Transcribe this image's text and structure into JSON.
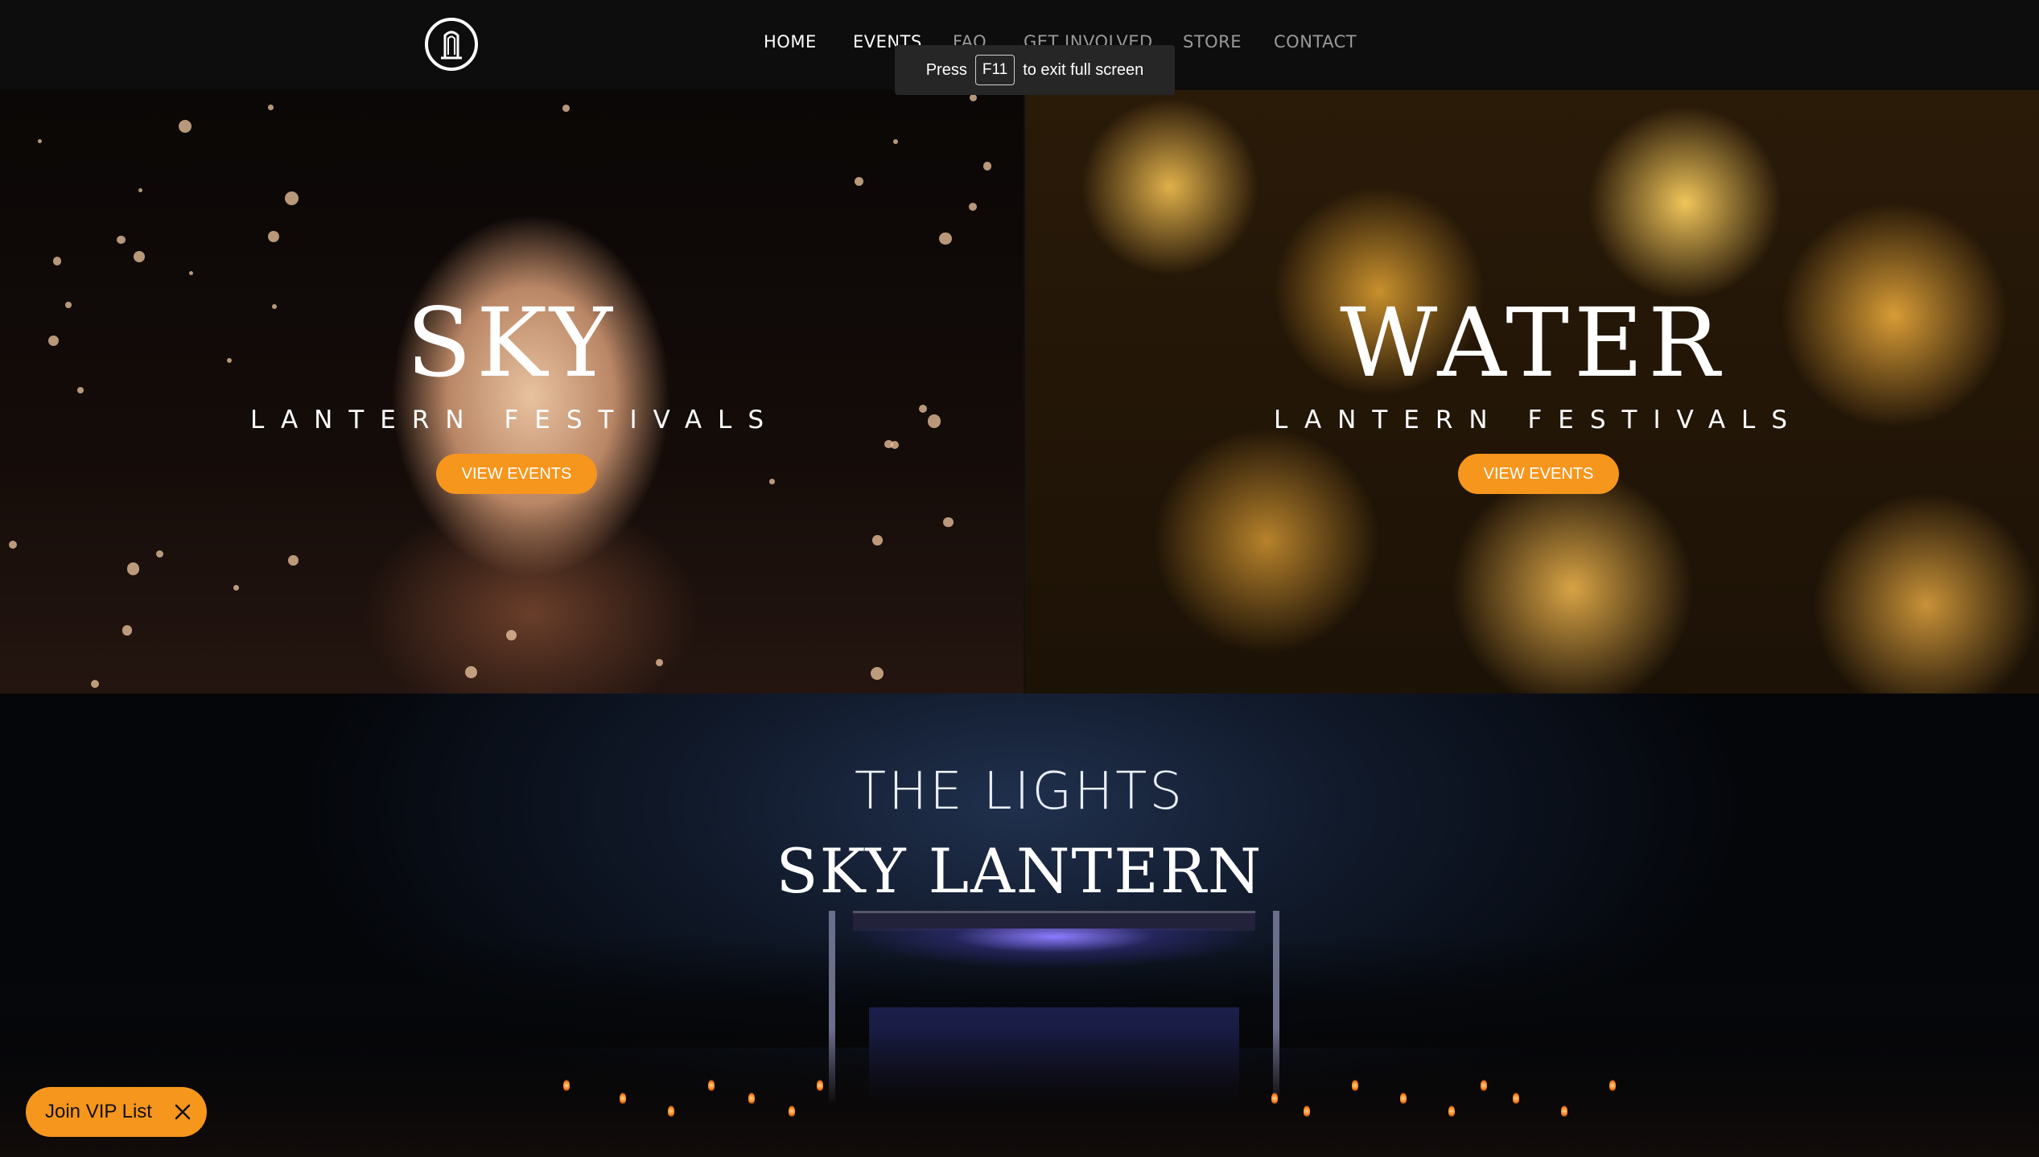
{
  "nav": {
    "items": [
      {
        "label": "HOME"
      },
      {
        "label": "EVENTS"
      },
      {
        "label": "FAQ"
      },
      {
        "label": "GET INVOLVED"
      },
      {
        "label": "STORE"
      },
      {
        "label": "CONTACT"
      }
    ]
  },
  "fullscreen_toast": {
    "press": "Press",
    "key": "F11",
    "suffix": "to exit full screen"
  },
  "sky_panel": {
    "title": "SKY",
    "subtitle": "LANTERN FESTIVALS",
    "button_label": "VIEW EVENTS"
  },
  "water_panel": {
    "title": "WATER",
    "subtitle": "LANTERN FESTIVALS",
    "button_label": "VIEW EVENTS"
  },
  "lights_section": {
    "title": "THE LIGHTS",
    "subtitle": "SKY LANTERN"
  },
  "vip": {
    "label": "Join VIP List"
  },
  "colors": {
    "accent": "#f7961d",
    "header_bg": "#0d0d0d"
  },
  "icons": [
    "logo-icon",
    "close-icon"
  ]
}
